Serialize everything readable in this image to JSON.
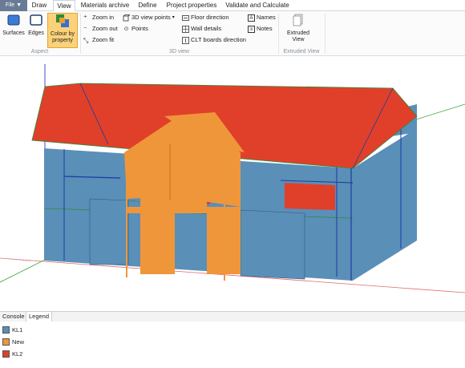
{
  "tabs": {
    "file": "File ▼",
    "items": [
      "Draw",
      "View",
      "Materials archive",
      "Define",
      "Project properties",
      "Validate and Calculate"
    ],
    "active_index": 1
  },
  "ribbon": {
    "aspect": {
      "label": "Aspect",
      "surfaces": "Surfaces",
      "edges": "Edges",
      "colour_line1": "Colour by",
      "colour_line2": "property"
    },
    "view3d": {
      "label": "3D view",
      "zoom_in": "Zoom in",
      "zoom_out": "Zoom out",
      "zoom_fit": "Zoom fit",
      "view_points": "3D view points",
      "points": "Points",
      "floor_direction": "Floor direction",
      "wall_details": "Wall details",
      "clt_boards": "CLT boards direction",
      "names": "Names",
      "notes": "Notes"
    },
    "extruded": {
      "label": "Extruded View",
      "button_line1": "Extruded",
      "button_line2": "View"
    }
  },
  "bottom_tabs": [
    "Console",
    "Legend"
  ],
  "legend": [
    {
      "label": "KL1",
      "color": "#5a8fb8"
    },
    {
      "label": "New",
      "color": "#f0963a"
    },
    {
      "label": "KL2",
      "color": "#e0402a"
    }
  ],
  "colors": {
    "wall_blue": "#5a8fb8",
    "roof_red": "#e0402a",
    "new_orange": "#f0963a",
    "accent": "#c9e1f6"
  }
}
